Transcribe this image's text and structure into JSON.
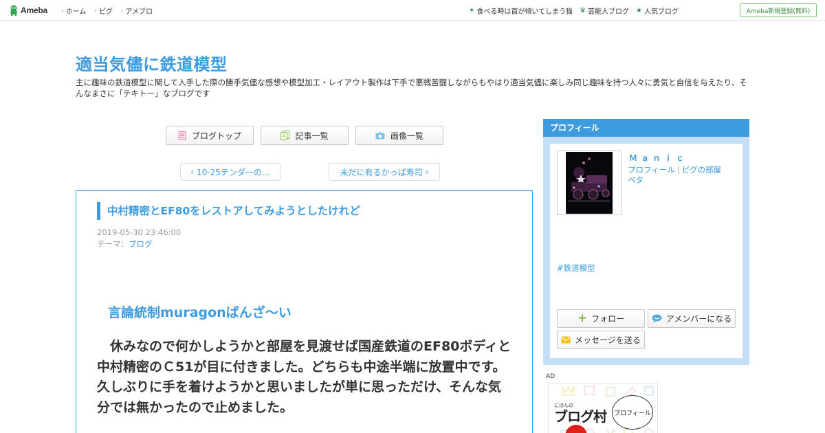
{
  "topbar": {
    "logo": "Ameba",
    "nav_left": [
      "ホーム",
      "ピグ",
      "アメブロ"
    ],
    "nav_right": [
      {
        "label": "食べる時は首が傾いてしまう猫",
        "icon": "sparkle-icon"
      },
      {
        "label": "芸能人ブログ",
        "icon": "crown-icon"
      },
      {
        "label": "人気ブログ",
        "icon": "star-icon"
      }
    ],
    "register": "Ameba新規登録(無料)"
  },
  "blog": {
    "title": "適当気儘に鉄道模型",
    "description": "主に趣味の鉄道模型に関して入手した際の勝手気儘な感想や模型加工・レイアウト製作は下手で悪戦苦闘しながらもやはり適当気儘に楽しみ同じ趣味を持つ人々に勇気と自信を与えたり、そんなまさに「テキトー」なブログです"
  },
  "nav_buttons": {
    "top": "ブログトップ",
    "list": "記事一覧",
    "images": "画像一覧"
  },
  "pager": {
    "prev": "10-25テンダーの…",
    "next": "未だに有るかっぱ寿司"
  },
  "article": {
    "title": "中村精密とEF80をレストアしてみようとしたけれど",
    "date": "2019-05-30 23:46:00",
    "theme_label": "テーマ：",
    "theme": "ブログ",
    "heading": "言論統制muragonばんざ～い",
    "body": "休みなので何かしようかと部屋を見渡せば国産鉄道のEF80ボディと中村精密のＣ51が目に付きました。どちらも中途半端に放置中です。久しぶりに手を着けようかと思いましたが単に思っただけ、そんな気分では無かったので止めました。"
  },
  "profile": {
    "header": "プロフィール",
    "name": "Ｍａｎｉｃ",
    "link_profile": "プロフィール",
    "link_room": "ピグの部屋",
    "link_peta": "ペタ",
    "hashtag": "#鉄道模型",
    "follow": "フォロー",
    "member": "アメンバーになる",
    "message": "メッセージを送る"
  },
  "ad": {
    "label": "AD",
    "brand_small": "にほんの",
    "brand": "ブログ村",
    "bubble": "プロフィール"
  },
  "colors": {
    "accent": "#3d9be0",
    "sidebar_bg": "#c4dff6",
    "ameba_green": "#2e8b57"
  }
}
